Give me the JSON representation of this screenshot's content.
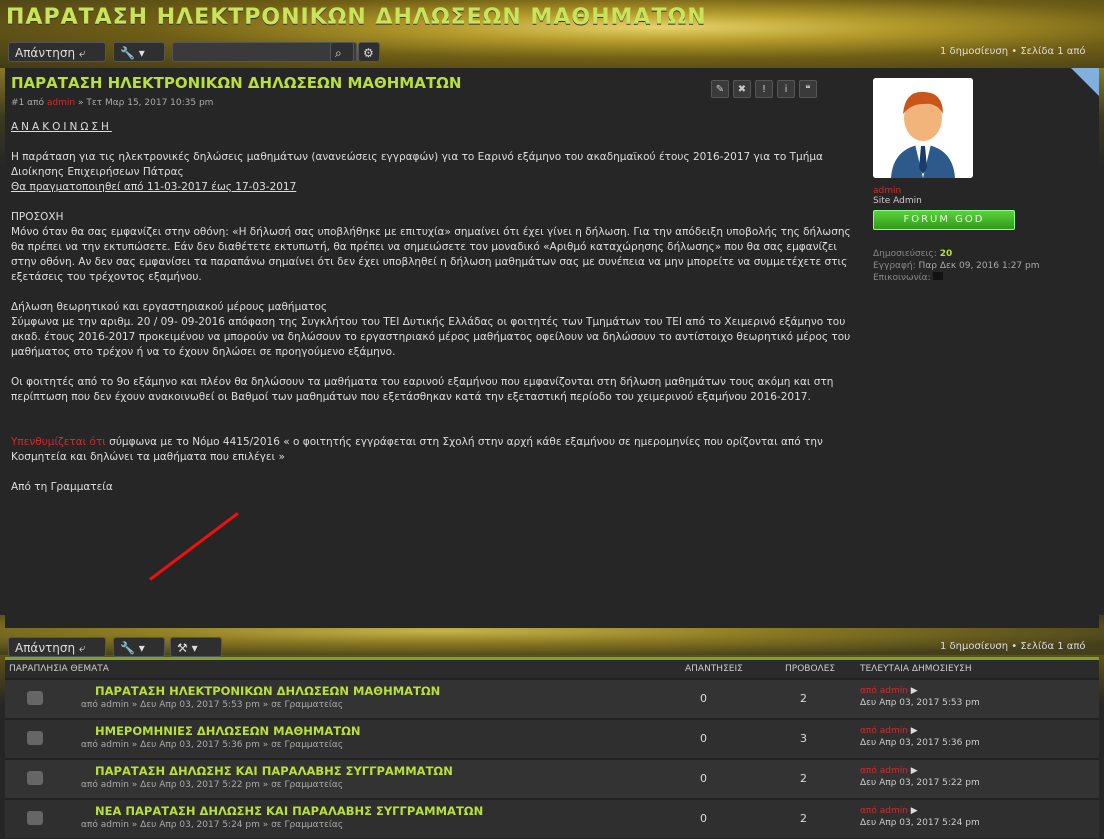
{
  "title": "ΠΑΡΑΤΑΣΗ ΗΛΕΚΤΡΟΝΙΚΩΝ ΔΗΛΩΣΕΩΝ ΜΑΘΗΜΑΤΩΝ",
  "toolbar": {
    "reply": "Απάντηση ⤶",
    "search_placeholder": "",
    "pagination": "1 δημοσίευση • Σελίδα 1 από"
  },
  "post": {
    "title": "ΠΑΡΑΤΑΣΗ ΗΛΕΚΤΡΟΝΙΚΩΝ ΔΗΛΩΣΕΩΝ ΜΑΘΗΜΑΤΩΝ",
    "meta_prefix": "#1 από",
    "meta_author": "admin",
    "meta_date": "» Τετ Μαρ 15, 2017 10:35 pm",
    "heading": "ΑΝΑΚΟΙΝΩΣΗ",
    "p1": "Η παράταση για τις ηλεκτρονικές δηλώσεις μαθημάτων (ανανεώσεις εγγραφών) για το Εαρινό εξάμηνο του ακαδημαϊκού έτους 2016-2017 για το Τμήμα Διοίκησης Επιχειρήσεων Πάτρας",
    "p1_under": "Θα πραγματοποιηθεί από 11-03-2017 έως 17-03-2017",
    "p2_head": "ΠΡΟΣΟΧΗ",
    "p2": "Μόνο όταν θα σας εμφανίζει στην οθόνη: «Η δήλωσή σας υποβλήθηκε με επιτυχία» σημαίνει ότι έχει γίνει η δήλωση. Για την απόδειξη υποβολής της δήλωσης θα πρέπει να την εκτυπώσετε. Εάν δεν διαθέτετε εκτυπωτή, θα πρέπει να σημειώσετε τον μοναδικό «Αριθμό καταχώρησης δήλωσης» που θα σας εμφανίζει στην οθόνη. Αν δεν σας εμφανίσει τα παραπάνω σημαίνει ότι δεν έχει υποβληθεί η δήλωση μαθημάτων σας με συνέπεια να μην μπορείτε να συμμετέχετε στις εξετάσεις του τρέχοντος εξαμήνου.",
    "p3_head": "Δήλωση θεωρητικού και εργαστηριακού μέρους μαθήματος",
    "p3": "Σύμφωνα με την αριθμ. 20 / 09- 09-2016 απόφαση της Συγκλήτου του ΤΕΙ Δυτικής Ελλάδας οι φοιτητές των Τμημάτων του ΤΕΙ από το Χειμερινό εξάμηνο του ακαδ. έτους 2016-2017 προκειμένου να μπορούν να δηλώσουν το εργαστηριακό μέρος μαθήματος οφείλουν να δηλώσουν το αντίστοιχο θεωρητικό μέρος του μαθήματος στο τρέχον ή να το έχουν δηλώσει σε προηγούμενο εξάμηνο.",
    "p4": "Οι φοιτητές από το 9ο εξάμηνο και πλέον θα δηλώσουν τα μαθήματα του εαρινού εξαμήνου που εμφανίζονται στη δήλωση μαθημάτων τους ακόμη και στη περίπτωση που δεν έχουν ανακοινωθεί οι Βαθμοί των μαθημάτων που εξετάσθηκαν κατά την εξεταστική περίοδο του χειμερινού εξαμήνου 2016-2017.",
    "p5_red": "Υπενθυμίζεται ότι",
    "p5": "σύμφωνα με το Νόμο 4415/2016 « ο φοιτητής εγγράφεται στη Σχολή στην αρχή κάθε εξαμήνου σε ημερομηνίες που ορίζονται από την Κοσμητεία και δηλώνει τα μαθήματα που επιλέγει »",
    "sign": "Από τη Γραμματεία"
  },
  "profile": {
    "name": "admin",
    "role": "Site Admin",
    "forum_btn": "FORUM GOD",
    "posts_label": "Δημοσιεύσεις:",
    "posts": "20",
    "joined_label": "Εγγραφή:",
    "joined": "Παρ Δεκ 09, 2016 1:27 pm",
    "contact_label": "Επικοινωνία:"
  },
  "table": {
    "headers": {
      "topics": "ΠΑΡΑΠΛΗΣΙΑ ΘΕΜΑΤΑ",
      "replies": "ΑΠΑΝΤΗΣΕΙΣ",
      "views": "ΠΡΟΒΟΛΕΣ",
      "last": "ΤΕΛΕΥΤΑΙΑ ΔΗΜΟΣΙΕΥΣΗ"
    },
    "rows": [
      {
        "title": "ΠΑΡΑΤΑΣΗ ΗΛΕΚΤΡΟΝΙΚΩΝ ΔΗΛΩΣΕΩΝ ΜΑΘΗΜΑΤΩΝ",
        "sub": "από admin » Δευ Απρ 03, 2017 5:53 pm » σε Γραμματείας",
        "replies": "0",
        "views": "2",
        "last_by": "από admin",
        "last_date": "Δευ Απρ 03, 2017 5:53 pm"
      },
      {
        "title": "ΗΜΕΡΟΜΗΝΙΕΣ ΔΗΛΩΣΕΩΝ ΜΑΘΗΜΑΤΩΝ",
        "sub": "από admin » Δευ Απρ 03, 2017 5:36 pm » σε Γραμματείας",
        "replies": "0",
        "views": "3",
        "last_by": "από admin",
        "last_date": "Δευ Απρ 03, 2017 5:36 pm"
      },
      {
        "title": "ΠΑΡΑΤΑΣΗ ΔΗΛΩΣΗΣ ΚΑΙ ΠΑΡΑΛΑΒΗΣ ΣΥΓΓΡΑΜΜΑΤΩΝ",
        "sub": "από admin » Δευ Απρ 03, 2017 5:22 pm » σε Γραμματείας",
        "replies": "0",
        "views": "2",
        "last_by": "από admin",
        "last_date": "Δευ Απρ 03, 2017 5:22 pm"
      },
      {
        "title": "ΝΕΑ ΠΑΡΑΤΑΣΗ ΔΗΛΩΣΗΣ ΚΑΙ ΠΑΡΑΛΑΒΗΣ ΣΥΓΓΡΑΜΜΑΤΩΝ",
        "sub": "από admin » Δευ Απρ 03, 2017 5:24 pm » σε Γραμματείας",
        "replies": "0",
        "views": "2",
        "last_by": "από admin",
        "last_date": "Δευ Απρ 03, 2017 5:24 pm"
      }
    ]
  }
}
